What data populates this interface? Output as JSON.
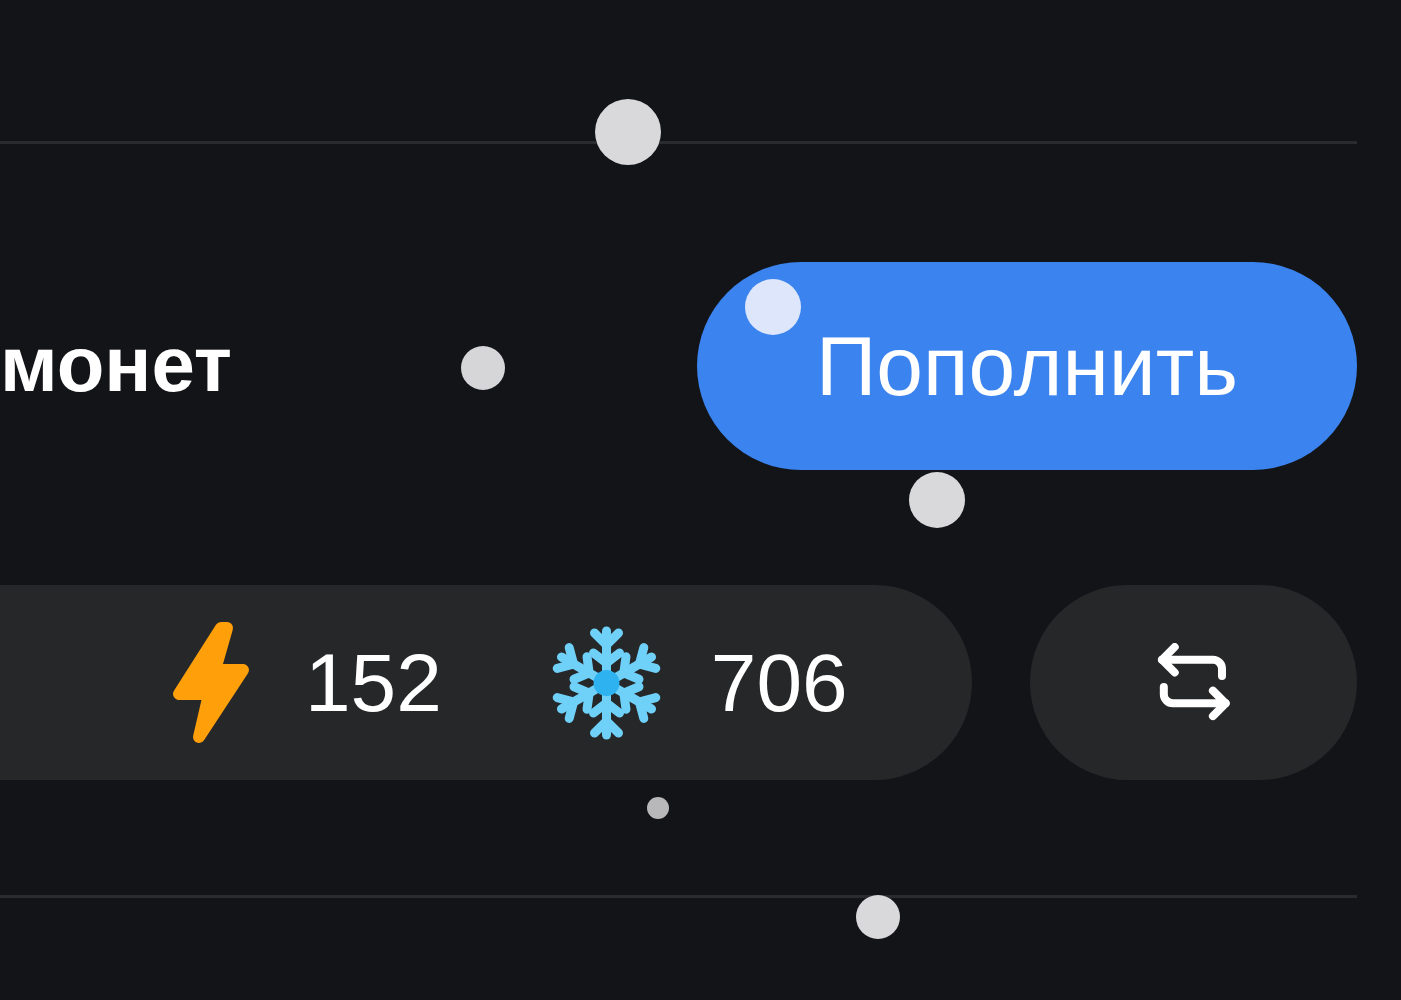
{
  "balance": {
    "label": "монет",
    "topup_button": "Пополнить"
  },
  "currencies": [
    {
      "kind": "energy",
      "amount": "152"
    },
    {
      "kind": "snow",
      "amount": "706"
    }
  ]
}
